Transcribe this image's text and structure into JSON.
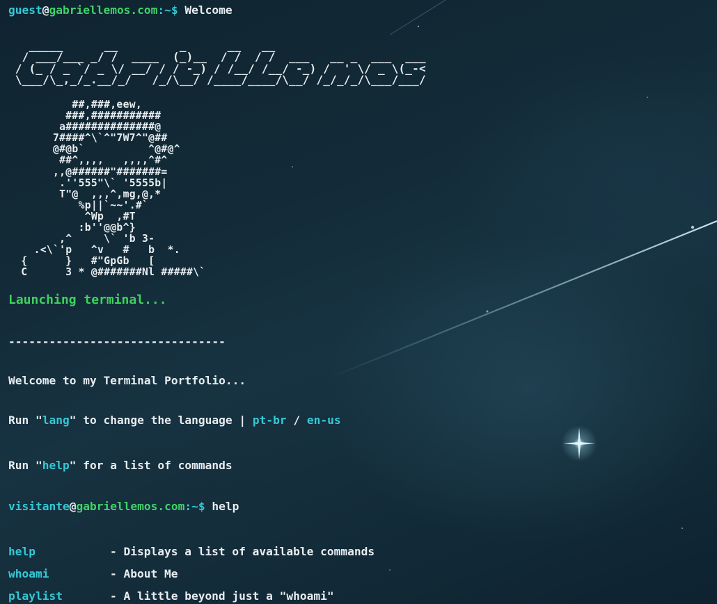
{
  "prompt1": {
    "user": "guest",
    "at": "@",
    "host": "gabriellemos.com",
    "path": ":~$",
    "command": "Welcome"
  },
  "banner_ascii": "   _____      __         _      __   __                              \n  / ___/___ _/ /  ____  (_)__  / /  / /  ___   __ _  ___  ___       \n / (_ / _ `/ _ \\/ __/ / / -_) / /__/ /__/ -_) /  ' \\/ _ \\(_-<       \n \\___/\\_,_/_.__/_/   /_/\\__/ /____/____/\\__/ /_/_/_/\\___/___/       ",
  "banner_text": "Gabriel Lemos",
  "art_ascii": "          ##,###,eew,\n         ###,###########\n        a##############@\n       7####^\\`^\"7W7^\"@##\n       @#@b`          ^@#@^\n        ##^,,,,   ,,,,^#^\n       ,,@######\"#######=\n        .''555\"\\` '5555b|\n        T\"@  ,,,^,mg,@,*\n           %p||`~~'.#`\n            ^Wp  ,#T\n           :b''@@b^}\n        ,^     \\` 'b 3-\n    .<\\`'p   ^v   #   b  *.\n  {      }   #\"GpGb   [\n  C      3 * @#######Nl #####\\`",
  "launching": "Launching terminal...",
  "divider": "--------------------------------",
  "welcome": "Welcome to my Terminal Portfolio...",
  "lang_line": {
    "run": "Run \"",
    "cmd": "lang",
    "middle": "\" to change the language | ",
    "opt1": "pt-br",
    "sep": " / ",
    "opt2": "en-us"
  },
  "help_line": {
    "run": "Run \"",
    "cmd": "help",
    "rest": "\" for a list of commands"
  },
  "prompt2": {
    "user": "visitante",
    "at": "@",
    "host": "gabriellemos.com",
    "path": ":~$",
    "command": "help"
  },
  "commands": [
    {
      "name": "help",
      "desc": "- Displays a list of available commands"
    },
    {
      "name": "whoami",
      "desc": "- About Me"
    },
    {
      "name": "playlist",
      "desc": "- A little beyond just a \"whoami\""
    }
  ],
  "colors": {
    "cyan": "#35c9d6",
    "green": "#3fd15f",
    "text": "#e8edf1",
    "background": "#132b38"
  }
}
